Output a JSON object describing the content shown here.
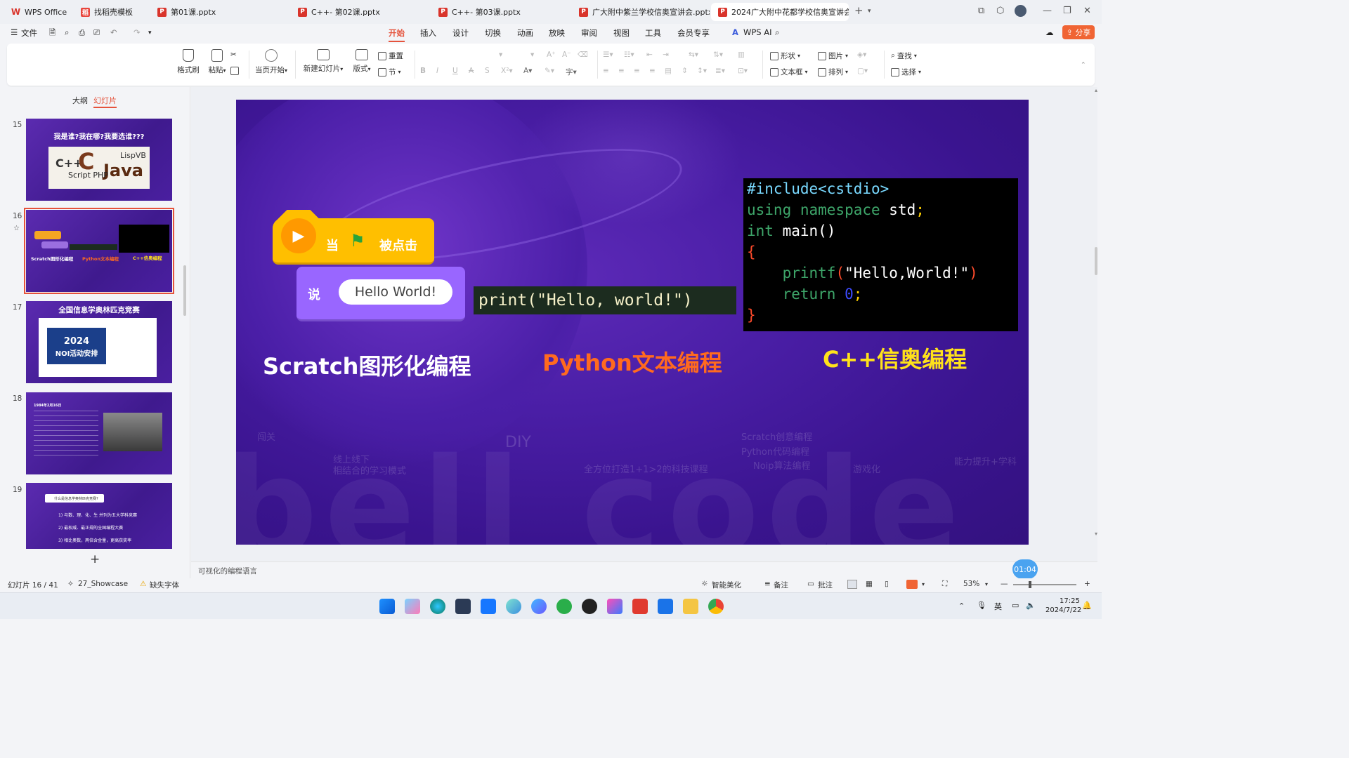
{
  "tabs": [
    {
      "label": "WPS Office",
      "icon": "wps-logo-icon"
    },
    {
      "label": "找稻壳模板",
      "icon": "docer-icon"
    },
    {
      "label": "第01课.pptx",
      "icon": "pptx-icon"
    },
    {
      "label": "C++- 第02课.pptx",
      "icon": "pptx-icon"
    },
    {
      "label": "C++- 第03课.pptx",
      "icon": "pptx-icon"
    },
    {
      "label": "广大附中紫兰学校信奥宣讲会.pptx",
      "icon": "pptx-icon"
    },
    {
      "label": "2024广大附中花都学校信奥宣讲会",
      "icon": "pptx-icon"
    }
  ],
  "menu": {
    "file": "文件",
    "items": [
      "开始",
      "插入",
      "设计",
      "切换",
      "动画",
      "放映",
      "审阅",
      "视图",
      "工具",
      "会员专享"
    ],
    "active": "开始",
    "wps_ai": "WPS AI",
    "share": "分享"
  },
  "ribbon": {
    "format_painter": "格式刷",
    "paste": "粘贴",
    "play_from_current": "当页开始",
    "new_slide": "新建幻灯片",
    "layout": "版式",
    "reset": "重置",
    "section": "节",
    "shape": "形状",
    "picture": "图片",
    "textbox": "文本框",
    "arrange": "排列",
    "find": "查找",
    "select": "选择"
  },
  "left_panel": {
    "tab_outline": "大纲",
    "tab_slides": "幻灯片",
    "thumbs": [
      {
        "num": "15",
        "title": "我是谁?我在哪?我要选谁???"
      },
      {
        "num": "16",
        "title": ""
      },
      {
        "num": "17",
        "title": "全国信息学奥林匹克竞赛",
        "sub_year": "2024",
        "sub_text": "NOI活动安排"
      },
      {
        "num": "18",
        "title": "1984年2月16日"
      },
      {
        "num": "19",
        "title": "什么是信息学奥林匹克竞赛?",
        "lines": [
          "1) 与数、理、化、生 并列为五大学科竞赛",
          "2) 最权威、最正规的全国编程大赛",
          "3) 相比奥数，两倍含金量，更高获奖率"
        ]
      }
    ],
    "add": "+"
  },
  "slide": {
    "scratch_when": "当",
    "scratch_clicked": "被点击",
    "scratch_say": "说",
    "scratch_hello": "Hello World!",
    "python_code": "print(\"Hello, world!\")",
    "cpp_lines": {
      "l1": "#include<cstdio>",
      "l2a": "using namespace ",
      "l2b": "std",
      "l2c": ";",
      "l3a": "int ",
      "l3b": "main",
      "l3c": "()",
      "l4": "{",
      "l5a": "    printf",
      "l5b": "(",
      "l5c": "\"Hello,World!\"",
      "l5d": ")",
      "l6a": "    return ",
      "l6b": "0",
      "l6c": ";",
      "l7": "}"
    },
    "label_scratch": "Scratch图形化编程",
    "label_python": "Python文本编程",
    "label_cpp": "C++信奥编程",
    "bg_text": {
      "watermark": "bell code",
      "diy": "DIY",
      "online": "线上线下",
      "online2": "相结合的学习模式",
      "fullrange": "全方位打造1+1>2的科技课程",
      "scratch_idea": "Scratch创意编程",
      "python_code": "Python代码编程",
      "noip": "Noip算法编程",
      "gamify": "游戏化",
      "ability": "能力提升+学科"
    }
  },
  "notes": "可视化的编程语言",
  "status": {
    "slide_pos": "幻灯片 16 / 41",
    "theme": "27_Showcase",
    "missing_font": "缺失字体",
    "beautify": "智能美化",
    "notes_btn": "备注",
    "comments": "批注",
    "zoom": "53%",
    "timer": "01:04"
  },
  "taskbar": {
    "ime": "英",
    "time": "17:25",
    "date": "2024/7/22"
  },
  "colors": {
    "accent": "#e5533c",
    "python_label": "#ff6a1f",
    "cpp_label": "#ffe21a",
    "slide_bg": "#4a1ea6"
  }
}
